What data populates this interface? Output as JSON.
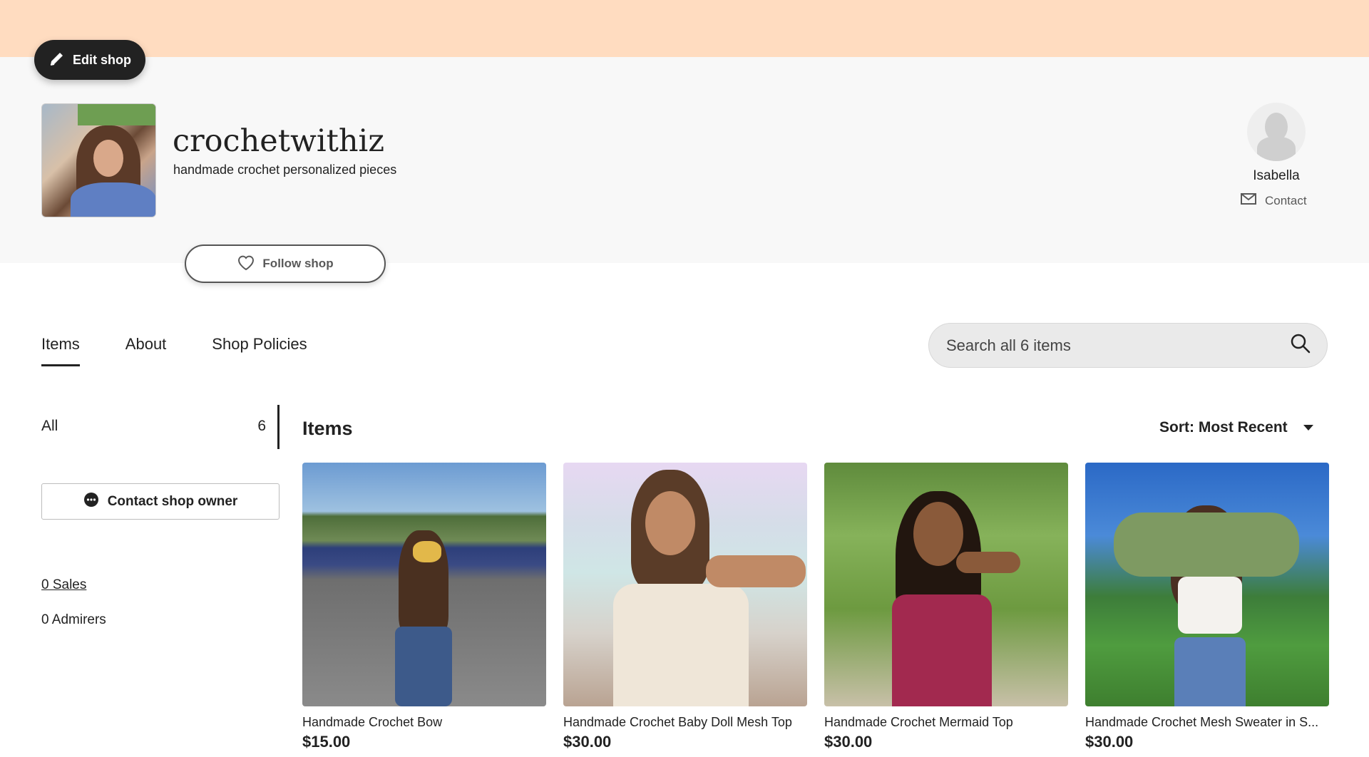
{
  "header": {
    "edit_shop_label": "Edit shop",
    "shop_name": "crochetwithiz",
    "tagline": "handmade crochet personalized pieces",
    "follow_label": "Follow shop",
    "owner_name": "Isabella",
    "contact_label": "Contact"
  },
  "tabs": [
    {
      "label": "Items",
      "active": true
    },
    {
      "label": "About",
      "active": false
    },
    {
      "label": "Shop Policies",
      "active": false
    }
  ],
  "search": {
    "placeholder": "Search all 6 items"
  },
  "sidebar": {
    "filter_label": "All",
    "filter_count": "6",
    "contact_owner_label": "Contact shop owner",
    "sales_label": "0 Sales",
    "admirers_label": "0 Admirers"
  },
  "items_section": {
    "title": "Items",
    "sort_label": "Sort: Most Recent"
  },
  "products": [
    {
      "name": "Handmade Crochet Bow",
      "price": "$15.00"
    },
    {
      "name": "Handmade Crochet Baby Doll Mesh Top",
      "price": "$30.00"
    },
    {
      "name": "Handmade Crochet Mermaid Top",
      "price": "$30.00"
    },
    {
      "name": "Handmade Crochet Mesh Sweater in S...",
      "price": "$30.00"
    }
  ],
  "colors": {
    "banner": "#ffdcc0",
    "header_band": "#f8f8f8",
    "dark": "#222222"
  },
  "icons": [
    "pencil-icon",
    "heart-icon",
    "envelope-icon",
    "search-icon",
    "chat-icon",
    "caret-down-icon"
  ]
}
